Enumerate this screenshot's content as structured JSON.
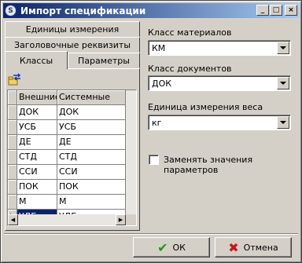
{
  "window": {
    "title": "Импорт спецификации",
    "app_icon_glyph": "S",
    "minimize_glyph": "_",
    "maximize_glyph": "□",
    "close_glyph": "×"
  },
  "tabs": {
    "units": "Единицы измерения",
    "header_props": "Заголовочные реквизиты",
    "classes": "Классы",
    "params": "Параметры",
    "active": "classes"
  },
  "grid": {
    "columns": [
      "Внешние",
      "Системные"
    ],
    "rows": [
      {
        "external": "ДОК",
        "system": "ДОК"
      },
      {
        "external": "УСБ",
        "system": "УСБ"
      },
      {
        "external": "ДЕ",
        "system": "ДЕ"
      },
      {
        "external": "СТД",
        "system": "СТД"
      },
      {
        "external": "ССИ",
        "system": "ССИ"
      },
      {
        "external": "ПОК",
        "system": "ПОК"
      },
      {
        "external": "М",
        "system": "М"
      },
      {
        "external": "УДЕ",
        "system": "УДЕ"
      }
    ],
    "current_row": 7
  },
  "right": {
    "material_class_label": "Класс материалов",
    "material_class_value": "КМ",
    "doc_class_label": "Класс документов",
    "doc_class_value": "ДОК",
    "weight_unit_label": "Единица измерения веса",
    "weight_unit_value": "кг",
    "replace_params_label": "Заменять значения параметров",
    "replace_params_checked": false
  },
  "buttons": {
    "ok": "ОК",
    "cancel": "Отмена"
  },
  "colors": {
    "titlebar_start": "#0a246a",
    "titlebar_end": "#a6caf0",
    "ok_check": "#1a9a1a",
    "cancel_x": "#c01818",
    "selection": "#0a246a"
  }
}
